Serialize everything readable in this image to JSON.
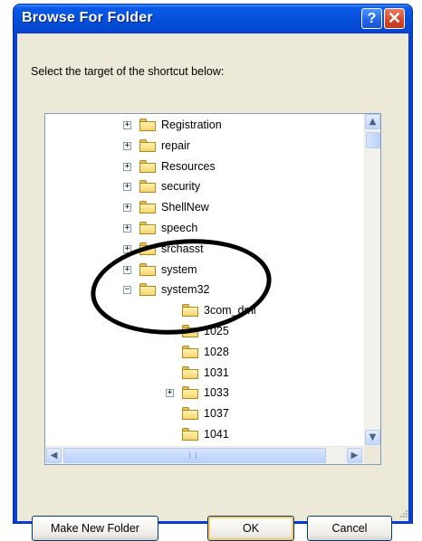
{
  "window": {
    "title": "Browse For Folder"
  },
  "instruction": "Select the target of the shortcut below:",
  "tree": [
    {
      "label": "Registration",
      "expander": "+"
    },
    {
      "label": "repair",
      "expander": "+"
    },
    {
      "label": "Resources",
      "expander": "+"
    },
    {
      "label": "security",
      "expander": "+"
    },
    {
      "label": "ShellNew",
      "expander": "+"
    },
    {
      "label": "speech",
      "expander": "+"
    },
    {
      "label": "srchasst",
      "expander": "+"
    },
    {
      "label": "system",
      "expander": "+"
    },
    {
      "label": "system32",
      "expander": "−"
    },
    {
      "label": "3com_dmi",
      "expander": ""
    },
    {
      "label": "1025",
      "expander": ""
    },
    {
      "label": "1028",
      "expander": ""
    },
    {
      "label": "1031",
      "expander": ""
    },
    {
      "label": "1033",
      "expander": "+"
    },
    {
      "label": "1037",
      "expander": ""
    },
    {
      "label": "1041",
      "expander": ""
    }
  ],
  "buttons": {
    "make_new_folder": "Make New Folder",
    "ok": "OK",
    "cancel": "Cancel"
  },
  "scrollbar": {
    "up": "▲",
    "down": "▼",
    "left": "◀",
    "right": "▶"
  },
  "colors": {
    "titlebar": "#0550dc",
    "face": "#ece9d8",
    "close": "#d5462a"
  }
}
